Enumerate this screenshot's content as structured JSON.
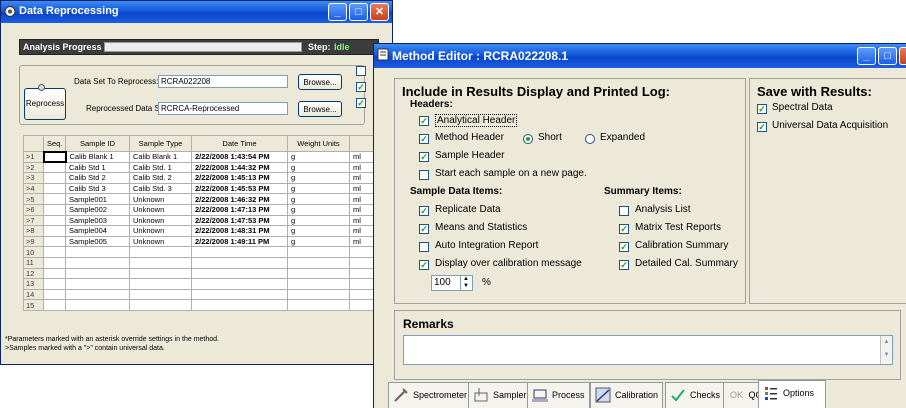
{
  "reprocess": {
    "title": "Data Reprocessing",
    "analysis_progress_label": "Analysis Progress",
    "step_label": "Step:",
    "step_value": "Idle",
    "reprocess_button": "Reprocess",
    "dataset_to_reprocess_label": "Data Set To Reprocess:",
    "dataset_to_reprocess_value": "RCRA022208",
    "reprocessed_dataset_label": "Reprocessed Data Set:",
    "reprocessed_dataset_value": "RCRCA-Reprocessed",
    "browse_label": "Browse...",
    "columns": [
      "Seq.",
      "Sample ID",
      "Sample Type",
      "Date Time",
      "Weight Units"
    ],
    "rows": [
      {
        "n": ">1",
        "id": "Calib Blank 1",
        "type": "Calib Blank 1",
        "dt": "2/22/2008 1:43:54 PM",
        "wu": "g",
        "ex": "ml"
      },
      {
        "n": ">2",
        "id": "Calib Std 1",
        "type": "Calib Std. 1",
        "dt": "2/22/2008 1:44:32 PM",
        "wu": "g",
        "ex": "ml"
      },
      {
        "n": ">3",
        "id": "Calib Std 2",
        "type": "Calib Std. 2",
        "dt": "2/22/2008 1:45:13 PM",
        "wu": "g",
        "ex": "ml"
      },
      {
        "n": ">4",
        "id": "Calib Std 3",
        "type": "Calib Std. 3",
        "dt": "2/22/2008 1:45:53 PM",
        "wu": "g",
        "ex": "ml"
      },
      {
        "n": ">5",
        "id": "Sample001",
        "type": "Unknown",
        "dt": "2/22/2008 1:46:32 PM",
        "wu": "g",
        "ex": "ml"
      },
      {
        "n": ">6",
        "id": "Sample002",
        "type": "Unknown",
        "dt": "2/22/2008 1:47:13 PM",
        "wu": "g",
        "ex": "ml"
      },
      {
        "n": ">7",
        "id": "Sample003",
        "type": "Unknown",
        "dt": "2/22/2008 1:47:53 PM",
        "wu": "g",
        "ex": "ml"
      },
      {
        "n": ">8",
        "id": "Sample004",
        "type": "Unknown",
        "dt": "2/22/2008 1:48:31 PM",
        "wu": "g",
        "ex": "ml"
      },
      {
        "n": ">9",
        "id": "Sample005",
        "type": "Unknown",
        "dt": "2/22/2008 1:49:11 PM",
        "wu": "g",
        "ex": "ml"
      }
    ],
    "empty_rows": [
      "10",
      "11",
      "12",
      "13",
      "14",
      "15"
    ],
    "footnote_1": "*Parameters marked with an asterisk override settings in the method.",
    "footnote_2": ">Samples marked with a \">\" contain universal data."
  },
  "editor": {
    "title": "Method Editor : RCRA022208.1",
    "include_heading": "Include in Results Display and Printed Log:",
    "headers_label": "Headers:",
    "analytical_header": "Analytical Header",
    "method_header": "Method Header",
    "short_label": "Short",
    "expanded_label": "Expanded",
    "sample_header": "Sample Header",
    "start_new_page": "Start each sample on a new page.",
    "sample_items_label": "Sample Data Items:",
    "replicate_data": "Replicate Data",
    "means_statistics": "Means and Statistics",
    "auto_integration": "Auto Integration Report",
    "display_over_cal": "Display over calibration message",
    "percent_value": "100",
    "percent_sign": "%",
    "summary_items_label": "Summary Items:",
    "analysis_list": "Analysis List",
    "matrix_test": "Matrix Test Reports",
    "calibration_summary": "Calibration Summary",
    "detailed_cal_summary": "Detailed Cal. Summary",
    "save_heading": "Save with Results:",
    "spectral_data": "Spectral Data",
    "universal_data": "Universal Data Acquisition",
    "remarks_label": "Remarks",
    "tabs": [
      "Spectrometer",
      "Sampler",
      "Process",
      "Calibration",
      "Checks",
      "QC",
      "Options"
    ],
    "qc_prefix": "OK"
  }
}
